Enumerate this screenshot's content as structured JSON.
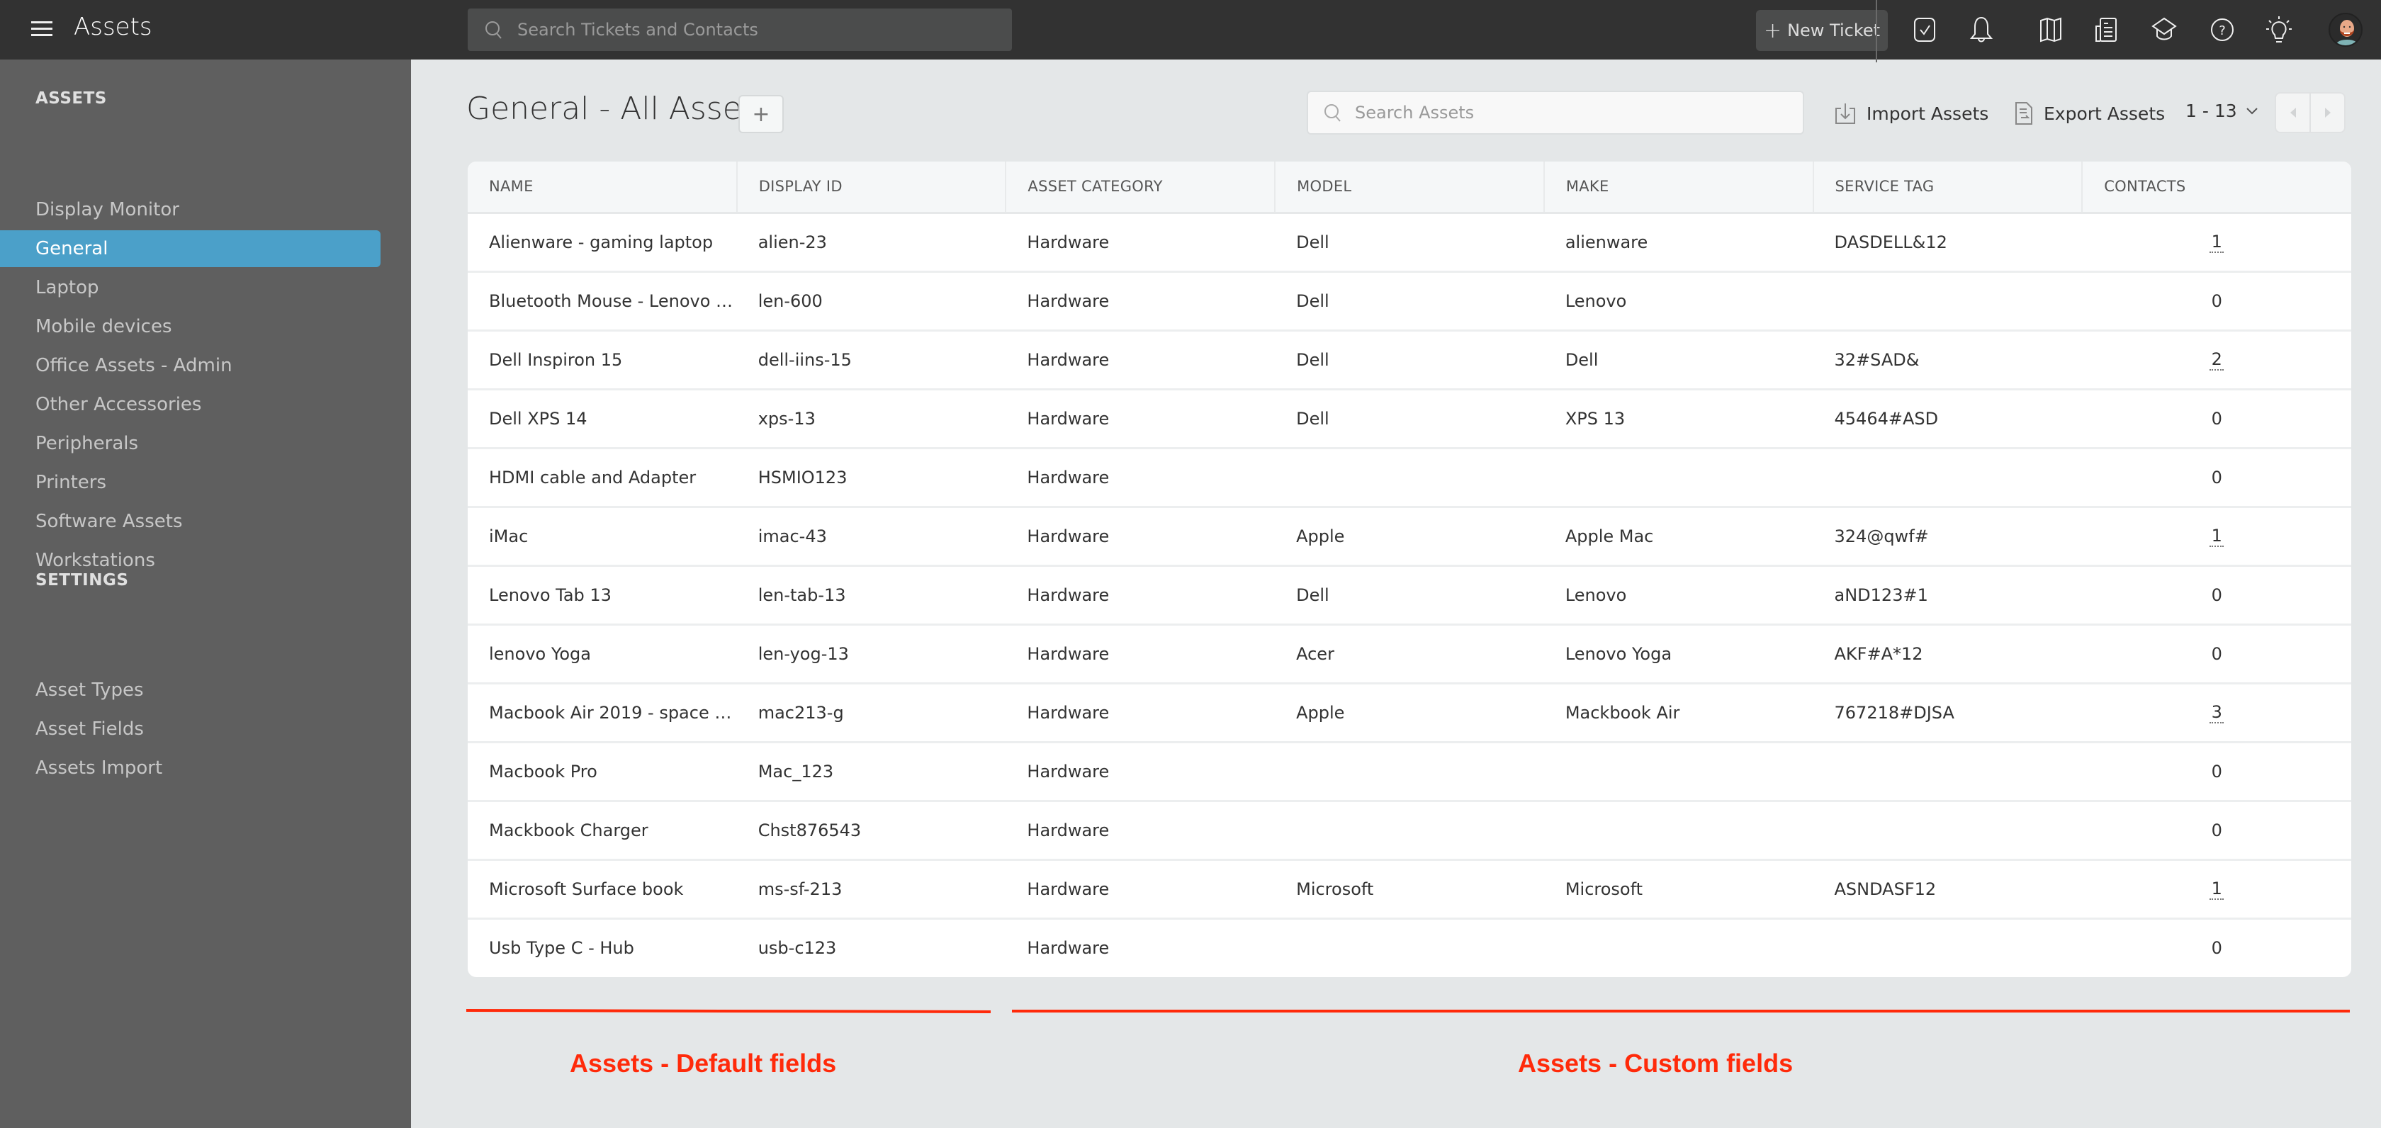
{
  "topbar": {
    "app_title": "Assets",
    "search_placeholder": "Search Tickets and Contacts",
    "new_ticket_label": "New Ticket",
    "icons": [
      "tasks-checkbox-icon",
      "bell-icon",
      "map-icon",
      "news-icon",
      "graduation-cap-icon",
      "help-icon",
      "lightbulb-icon"
    ]
  },
  "sidebar": {
    "assets_heading": "ASSETS",
    "asset_items": [
      {
        "label": "Display Monitor",
        "active": false
      },
      {
        "label": "General",
        "active": true
      },
      {
        "label": "Laptop",
        "active": false
      },
      {
        "label": "Mobile devices",
        "active": false
      },
      {
        "label": "Office Assets - Admin",
        "active": false
      },
      {
        "label": "Other Accessories",
        "active": false
      },
      {
        "label": "Peripherals",
        "active": false
      },
      {
        "label": "Printers",
        "active": false
      },
      {
        "label": "Software Assets",
        "active": false
      },
      {
        "label": "Workstations",
        "active": false
      }
    ],
    "settings_heading": "SETTINGS",
    "settings_items": [
      {
        "label": "Asset Types"
      },
      {
        "label": "Asset Fields"
      },
      {
        "label": "Assets Import"
      }
    ]
  },
  "main": {
    "title": "General - All Assets",
    "add_label": "+",
    "search_placeholder": "Search Assets",
    "import_label": "Import Assets",
    "export_label": "Export Assets",
    "pagination": "1 - 13"
  },
  "table": {
    "columns": [
      "NAME",
      "DISPLAY ID",
      "ASSET CATEGORY",
      "MODEL",
      "MAKE",
      "SERVICE TAG",
      "CONTACTS"
    ],
    "rows": [
      {
        "name": "Alienware - gaming laptop",
        "display_id": "alien-23",
        "category": "Hardware",
        "model": "Dell",
        "make": "alienware",
        "service_tag": "DASDELL&12",
        "contacts": "1"
      },
      {
        "name": "Bluetooth Mouse - Lenovo …",
        "display_id": "len-600",
        "category": "Hardware",
        "model": "Dell",
        "make": "Lenovo",
        "service_tag": "",
        "contacts": "0"
      },
      {
        "name": "Dell Inspiron 15",
        "display_id": "dell-iins-15",
        "category": "Hardware",
        "model": "Dell",
        "make": "Dell",
        "service_tag": "32#SAD&",
        "contacts": "2"
      },
      {
        "name": "Dell XPS 14",
        "display_id": "xps-13",
        "category": "Hardware",
        "model": "Dell",
        "make": "XPS 13",
        "service_tag": "45464#ASD",
        "contacts": "0"
      },
      {
        "name": "HDMI cable and Adapter",
        "display_id": "HSMIO123",
        "category": "Hardware",
        "model": "",
        "make": "",
        "service_tag": "",
        "contacts": "0"
      },
      {
        "name": "iMac",
        "display_id": "imac-43",
        "category": "Hardware",
        "model": "Apple",
        "make": "Apple Mac",
        "service_tag": "324@qwf#",
        "contacts": "1"
      },
      {
        "name": "Lenovo Tab 13",
        "display_id": "len-tab-13",
        "category": "Hardware",
        "model": "Dell",
        "make": "Lenovo",
        "service_tag": "aND123#1",
        "contacts": "0"
      },
      {
        "name": "lenovo Yoga",
        "display_id": "len-yog-13",
        "category": "Hardware",
        "model": "Acer",
        "make": "Lenovo Yoga",
        "service_tag": "AKF#A*12",
        "contacts": "0"
      },
      {
        "name": "Macbook Air 2019 - space …",
        "display_id": "mac213-g",
        "category": "Hardware",
        "model": "Apple",
        "make": "Mackbook Air",
        "service_tag": "767218#DJSA",
        "contacts": "3"
      },
      {
        "name": "Macbook Pro",
        "display_id": "Mac_123",
        "category": "Hardware",
        "model": "",
        "make": "",
        "service_tag": "",
        "contacts": "0"
      },
      {
        "name": "Mackbook Charger",
        "display_id": "Chst876543",
        "category": "Hardware",
        "model": "",
        "make": "",
        "service_tag": "",
        "contacts": "0"
      },
      {
        "name": "Microsoft Surface book",
        "display_id": "ms-sf-213",
        "category": "Hardware",
        "model": "Microsoft",
        "make": "Microsoft",
        "service_tag": "ASNDASF12",
        "contacts": "1"
      },
      {
        "name": "Usb Type C - Hub",
        "display_id": "usb-c123",
        "category": "Hardware",
        "model": "",
        "make": "",
        "service_tag": "",
        "contacts": "0"
      }
    ]
  },
  "annotations": {
    "default_fields_label": "Assets - Default fields",
    "custom_fields_label": "Assets - Custom fields",
    "color": "#ff2a0a"
  },
  "colors": {
    "topbar_bg": "#323232",
    "sidebar_bg": "#5f5f5f",
    "sidebar_active": "#4ba0c9",
    "page_bg": "#e4e7e8"
  }
}
